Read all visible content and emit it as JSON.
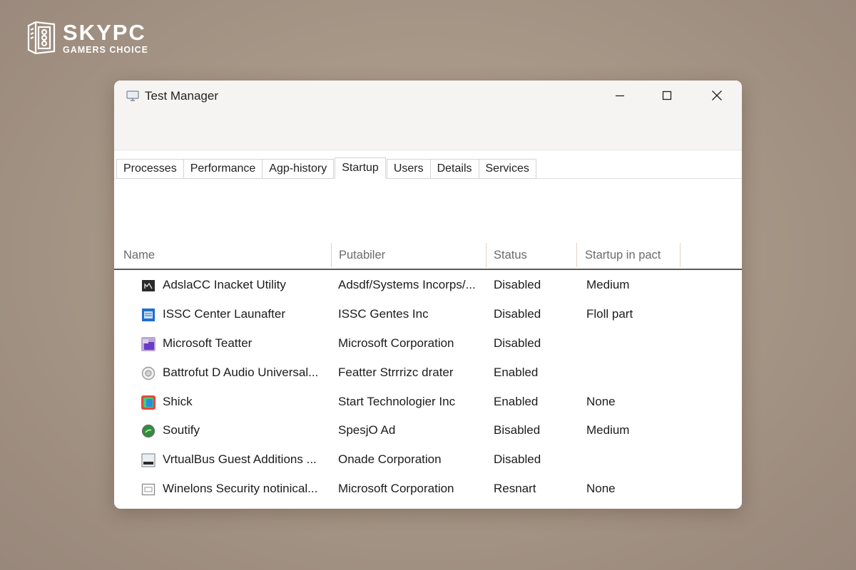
{
  "logo": {
    "name": "SKYPC",
    "tagline": "GAMERS CHOICE"
  },
  "window": {
    "title": "Test Manager",
    "controls": {
      "minimize": "minimize-icon",
      "maximize": "maximize-icon",
      "close": "close-icon"
    }
  },
  "tabs": [
    {
      "label": "Processes"
    },
    {
      "label": "Performance"
    },
    {
      "label": "Agp-history"
    },
    {
      "label": "Startup",
      "active": true
    },
    {
      "label": "Users"
    },
    {
      "label": "Details"
    },
    {
      "label": "Services"
    }
  ],
  "table": {
    "columns": [
      "Name",
      "Putabiler",
      "Status",
      "Startup in pact"
    ],
    "rows": [
      {
        "icon": "dark-app-icon",
        "name": "AdslaCC Inacket Utility",
        "publisher": "Adsdf/Systems Incorps/...",
        "status": "Disabled",
        "impact": "Medium"
      },
      {
        "icon": "blue-window-icon",
        "name": "ISSC Center Launafter",
        "publisher": "ISSC Gentes Inc",
        "status": "Disabled",
        "impact": "Floll part"
      },
      {
        "icon": "purple-app-icon",
        "name": "Microsoft Teatter",
        "publisher": "Microsoft Corporation",
        "status": "Disabled",
        "impact": ""
      },
      {
        "icon": "audio-circle-icon",
        "name": "Battrofut D Audio Universal...",
        "publisher": "Featter Strrrizc drater",
        "status": "Enabled",
        "impact": ""
      },
      {
        "icon": "colorful-app-icon",
        "name": "Shick",
        "publisher": "Start Technologier Inc",
        "status": "Enabled",
        "impact": "None"
      },
      {
        "icon": "green-circle-icon",
        "name": "Soutify",
        "publisher": "SpesjO Ad",
        "status": "Bisabled",
        "impact": "Medium"
      },
      {
        "icon": "vm-box-icon",
        "name": "VrtualBus Guest Additions ...",
        "publisher": "Onade Corporation",
        "status": "Disabled",
        "impact": ""
      },
      {
        "icon": "shield-window-icon",
        "name": "Winelons Security notinical...",
        "publisher": "Microsoft Corporation",
        "status": "Resnart",
        "impact": "None"
      }
    ]
  },
  "colors": {
    "background": "#a89888",
    "window": "#ffffff",
    "titlebar": "#f5f4f3",
    "header_text": "#6b6b6b",
    "header_separator": "#e7cfc6"
  }
}
